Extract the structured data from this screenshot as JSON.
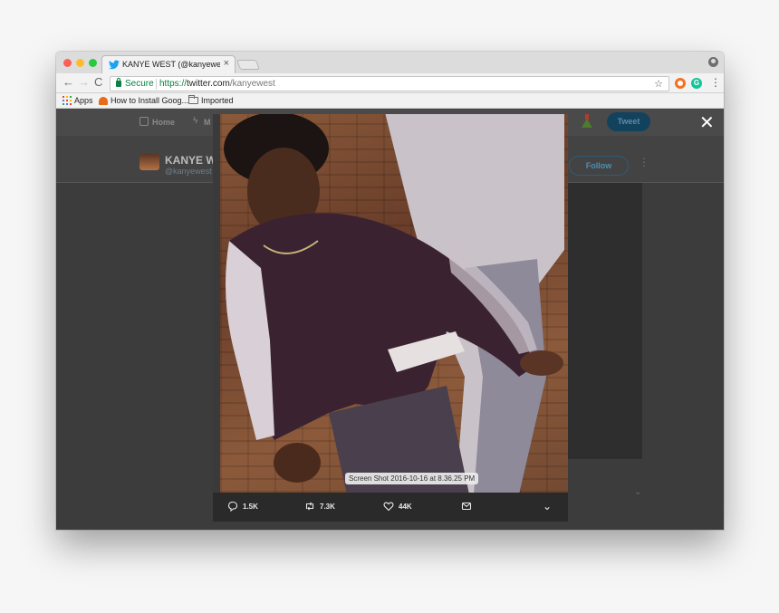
{
  "browser": {
    "tab_title": "KANYE WEST (@kanyewest) | T",
    "tab_close": "×",
    "secure_label": "Secure",
    "url_scheme": "https://",
    "url_host": "twitter.com",
    "url_path": "/kanyewest",
    "extension_letter": "G",
    "bookmarks": [
      {
        "label": "Apps"
      },
      {
        "label": "How to Install Goog..."
      },
      {
        "label": "Imported"
      }
    ]
  },
  "twitter": {
    "nav_home": "Home",
    "nav_moments": "M",
    "tweet_button": "Tweet",
    "profile_name": "KANYE W",
    "profile_handle": "@kanyewest",
    "follow_button": "Follow",
    "more": "⋮",
    "chevron": "⌄"
  },
  "lightbox": {
    "close": "✕",
    "caption": "Screen Shot 2016-10-16 at 8.36.25 PM",
    "actions": {
      "replies": "1.5K",
      "retweets": "7.3K",
      "likes": "44K",
      "more": "⌄"
    }
  },
  "colors": {
    "secure_green": "#0b8043",
    "twitter_blue": "#1da1f2",
    "overlay": "#3c3c3c"
  }
}
